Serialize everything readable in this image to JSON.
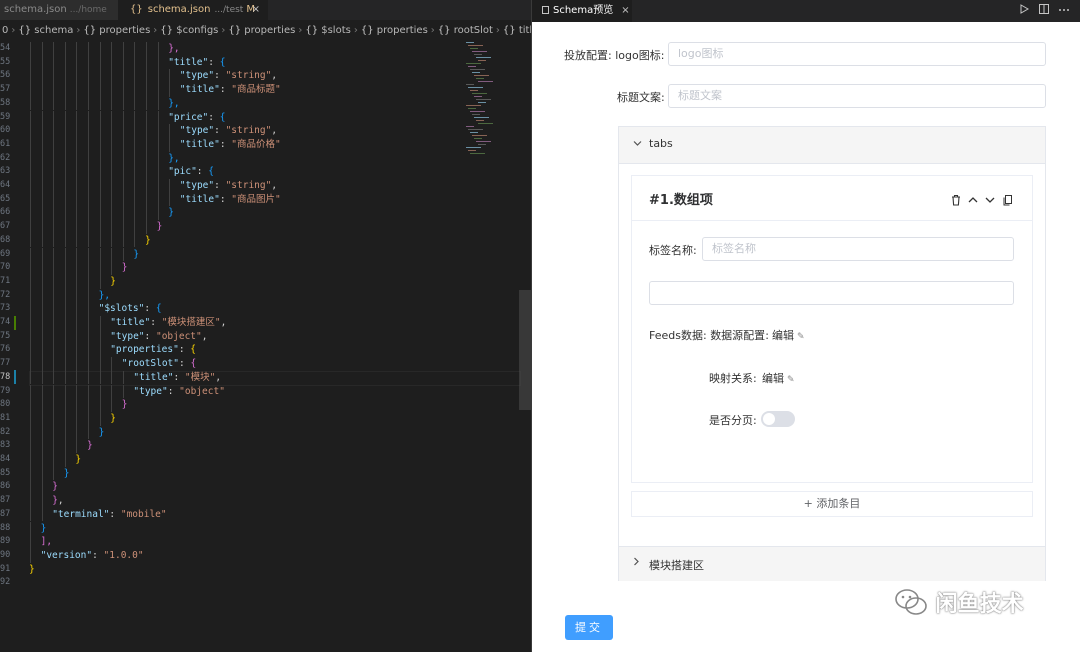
{
  "editor": {
    "tabs": [
      {
        "name": "schema.json",
        "path": ".../home"
      },
      {
        "name": "schema.json",
        "path": ".../test",
        "status": "M",
        "close": "×"
      }
    ],
    "file_icon": "{}",
    "breadcrumb": [
      "0",
      "schema",
      "properties",
      "$configs",
      "properties",
      "$slots",
      "properties",
      "rootSlot",
      "title"
    ],
    "current_line": 78,
    "lines": [
      {
        "n": "54",
        "indent": 12,
        "tokens": [
          [
            "b2",
            "},"
          ]
        ]
      },
      {
        "n": "55",
        "indent": 12,
        "tokens": [
          [
            "k",
            "\"title\""
          ],
          [
            "p",
            ": "
          ],
          [
            "b3",
            "{"
          ]
        ]
      },
      {
        "n": "56",
        "indent": 13,
        "tokens": [
          [
            "k",
            "\"type\""
          ],
          [
            "p",
            ": "
          ],
          [
            "s",
            "\"string\""
          ],
          [
            "p",
            ","
          ]
        ]
      },
      {
        "n": "57",
        "indent": 13,
        "tokens": [
          [
            "k",
            "\"title\""
          ],
          [
            "p",
            ": "
          ],
          [
            "s",
            "\"商品标题\""
          ]
        ]
      },
      {
        "n": "58",
        "indent": 12,
        "tokens": [
          [
            "b3",
            "},"
          ]
        ]
      },
      {
        "n": "59",
        "indent": 12,
        "tokens": [
          [
            "k",
            "\"price\""
          ],
          [
            "p",
            ": "
          ],
          [
            "b3",
            "{"
          ]
        ]
      },
      {
        "n": "60",
        "indent": 13,
        "tokens": [
          [
            "k",
            "\"type\""
          ],
          [
            "p",
            ": "
          ],
          [
            "s",
            "\"string\""
          ],
          [
            "p",
            ","
          ]
        ]
      },
      {
        "n": "61",
        "indent": 13,
        "tokens": [
          [
            "k",
            "\"title\""
          ],
          [
            "p",
            ": "
          ],
          [
            "s",
            "\"商品价格\""
          ]
        ]
      },
      {
        "n": "62",
        "indent": 12,
        "tokens": [
          [
            "b3",
            "},"
          ]
        ]
      },
      {
        "n": "63",
        "indent": 12,
        "tokens": [
          [
            "k",
            "\"pic\""
          ],
          [
            "p",
            ": "
          ],
          [
            "b3",
            "{"
          ]
        ]
      },
      {
        "n": "64",
        "indent": 13,
        "tokens": [
          [
            "k",
            "\"type\""
          ],
          [
            "p",
            ": "
          ],
          [
            "s",
            "\"string\""
          ],
          [
            "p",
            ","
          ]
        ]
      },
      {
        "n": "65",
        "indent": 13,
        "tokens": [
          [
            "k",
            "\"title\""
          ],
          [
            "p",
            ": "
          ],
          [
            "s",
            "\"商品图片\""
          ]
        ]
      },
      {
        "n": "66",
        "indent": 12,
        "tokens": [
          [
            "b3",
            "}"
          ]
        ]
      },
      {
        "n": "67",
        "indent": 11,
        "tokens": [
          [
            "b2",
            "}"
          ]
        ]
      },
      {
        "n": "68",
        "indent": 10,
        "tokens": [
          [
            "b1",
            "}"
          ]
        ]
      },
      {
        "n": "69",
        "indent": 9,
        "tokens": [
          [
            "b3",
            "}"
          ]
        ]
      },
      {
        "n": "70",
        "indent": 8,
        "tokens": [
          [
            "b2",
            "}"
          ]
        ]
      },
      {
        "n": "71",
        "indent": 7,
        "tokens": [
          [
            "b1",
            "}"
          ]
        ]
      },
      {
        "n": "72",
        "indent": 6,
        "tokens": [
          [
            "b3",
            "},"
          ]
        ]
      },
      {
        "n": "73",
        "indent": 6,
        "tokens": [
          [
            "k",
            "\"$slots\""
          ],
          [
            "p",
            ": "
          ],
          [
            "b3",
            "{"
          ]
        ]
      },
      {
        "n": "74",
        "indent": 7,
        "tokens": [
          [
            "k",
            "\"title\""
          ],
          [
            "p",
            ": "
          ],
          [
            "s",
            "\"模块搭建区\""
          ],
          [
            "p",
            ","
          ]
        ]
      },
      {
        "n": "75",
        "indent": 7,
        "tokens": [
          [
            "k",
            "\"type\""
          ],
          [
            "p",
            ": "
          ],
          [
            "s",
            "\"object\""
          ],
          [
            "p",
            ","
          ]
        ]
      },
      {
        "n": "76",
        "indent": 7,
        "tokens": [
          [
            "k",
            "\"properties\""
          ],
          [
            "p",
            ": "
          ],
          [
            "b1",
            "{"
          ]
        ]
      },
      {
        "n": "77",
        "indent": 8,
        "tokens": [
          [
            "k",
            "\"rootSlot\""
          ],
          [
            "p",
            ": "
          ],
          [
            "b2",
            "{"
          ]
        ]
      },
      {
        "n": "78",
        "indent": 9,
        "tokens": [
          [
            "k",
            "\"title\""
          ],
          [
            "p",
            ": "
          ],
          [
            "s",
            "\"模块\""
          ],
          [
            "p",
            ","
          ]
        ]
      },
      {
        "n": "79",
        "indent": 9,
        "tokens": [
          [
            "k",
            "\"type\""
          ],
          [
            "p",
            ": "
          ],
          [
            "s",
            "\"object\""
          ]
        ]
      },
      {
        "n": "80",
        "indent": 8,
        "tokens": [
          [
            "b2",
            "}"
          ]
        ]
      },
      {
        "n": "81",
        "indent": 7,
        "tokens": [
          [
            "b1",
            "}"
          ]
        ]
      },
      {
        "n": "82",
        "indent": 6,
        "tokens": [
          [
            "b3",
            "}"
          ]
        ]
      },
      {
        "n": "83",
        "indent": 5,
        "tokens": [
          [
            "b2",
            "}"
          ]
        ]
      },
      {
        "n": "84",
        "indent": 4,
        "tokens": [
          [
            "b1",
            "}"
          ]
        ]
      },
      {
        "n": "85",
        "indent": 3,
        "tokens": [
          [
            "b3",
            "}"
          ]
        ]
      },
      {
        "n": "86",
        "indent": 2,
        "tokens": [
          [
            "b2",
            "}"
          ]
        ]
      },
      {
        "n": "87",
        "indent": 2,
        "tokens": [
          [
            "b2",
            "}"
          ],
          [
            "p",
            ","
          ]
        ]
      },
      {
        "n": "87",
        "indent": 2,
        "tokens": [
          [
            "k",
            "\"terminal\""
          ],
          [
            "p",
            ": "
          ],
          [
            "s",
            "\"mobile\""
          ]
        ]
      },
      {
        "n": "88",
        "indent": 1,
        "tokens": [
          [
            "b3",
            "}"
          ]
        ]
      },
      {
        "n": "89",
        "indent": 1,
        "tokens": [
          [
            "b2",
            "],"
          ]
        ]
      },
      {
        "n": "90",
        "indent": 1,
        "tokens": [
          [
            "k",
            "\"version\""
          ],
          [
            "p",
            ": "
          ],
          [
            "s",
            "\"1.0.0\""
          ]
        ]
      },
      {
        "n": "91",
        "indent": 0,
        "tokens": [
          [
            "b1",
            "}"
          ]
        ]
      },
      {
        "n": "92",
        "indent": 0,
        "tokens": []
      }
    ]
  },
  "preview": {
    "tab_title": "Schema预览",
    "tab_close": "×",
    "actions": [
      "run-icon",
      "split-editor-icon",
      "more-icon"
    ],
    "fields": {
      "config_group": "投放配置",
      "logo_label": "logo图标",
      "logo_placeholder": "logo图标",
      "title_label": "标题文案",
      "title_placeholder": "标题文案"
    },
    "tabs_section": {
      "title": "tabs",
      "item_title": "#1.数组项",
      "tag_label": "标签名称",
      "tag_placeholder": "标签名称",
      "feeds_label": "Feeds数据",
      "datasource_label": "数据源配置",
      "edit1": "编辑",
      "mapping_label": "映射关系",
      "edit2": "编辑",
      "paging_label": "是否分页",
      "paging_on": false,
      "add_item": "添加条目"
    },
    "slot_section": {
      "title": "模块搭建区"
    },
    "submit": "提交"
  },
  "watermark": "闲鱼技术",
  "colors": {
    "primary": "#409eff",
    "editor_bg": "#1e1e1e",
    "string": "#ce9178",
    "key": "#9cdcfe"
  }
}
